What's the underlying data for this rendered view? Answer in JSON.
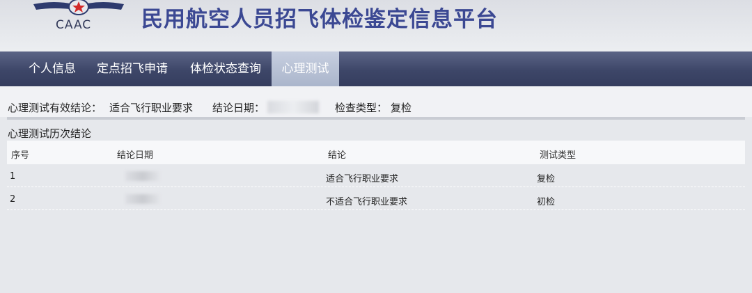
{
  "header": {
    "logo_text": "CAAC",
    "title": "民用航空人员招飞体检鉴定信息平台"
  },
  "nav": {
    "items": [
      {
        "label": "个人信息"
      },
      {
        "label": "定点招飞申请"
      },
      {
        "label": "体检状态查询"
      },
      {
        "label": "心理测试"
      }
    ],
    "active_index": 3
  },
  "summary": {
    "conclusion_label": "心理测试有效结论：",
    "conclusion_value": "适合飞行职业要求",
    "date_label": "结论日期：",
    "date_value": "",
    "type_label": "检查类型：",
    "type_value": "复检"
  },
  "history": {
    "title": "心理测试历次结论",
    "columns": [
      "序号",
      "结论日期",
      "结论",
      "测试类型"
    ],
    "rows": [
      {
        "index": "1",
        "date": "",
        "conclusion": "适合飞行职业要求",
        "type": "复检"
      },
      {
        "index": "2",
        "date": "",
        "conclusion": "不适合飞行职业要求",
        "type": "初检"
      }
    ]
  }
}
